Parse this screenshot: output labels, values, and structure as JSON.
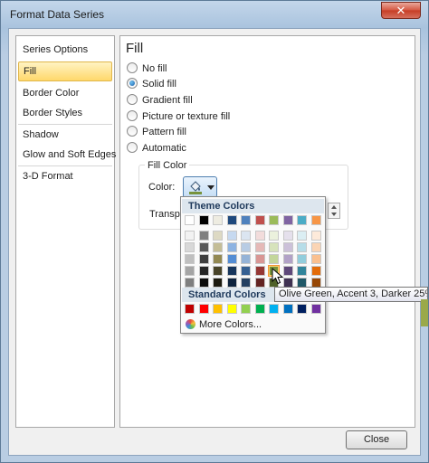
{
  "window": {
    "title": "Format Data Series",
    "close_glyph": "✕"
  },
  "nav": {
    "items": [
      {
        "label": "Series Options"
      },
      {
        "label": "Fill"
      },
      {
        "label": "Border Color"
      },
      {
        "label": "Border Styles"
      },
      {
        "label": "Shadow"
      },
      {
        "label": "Glow and Soft Edges"
      },
      {
        "label": "3-D Format"
      }
    ],
    "selected": "Fill"
  },
  "fill": {
    "heading": "Fill",
    "options": [
      {
        "label": "No fill",
        "selected": false
      },
      {
        "label": "Solid fill",
        "selected": true
      },
      {
        "label": "Gradient fill",
        "selected": false
      },
      {
        "label": "Picture or texture fill",
        "selected": false
      },
      {
        "label": "Pattern fill",
        "selected": false
      },
      {
        "label": "Automatic",
        "selected": false
      }
    ],
    "fill_color_group": "Fill Color",
    "color_label": "Color:",
    "transparency_label": "Transparency:",
    "color_button_icon": "paint-bucket-icon",
    "current_color": "#77933c"
  },
  "palette": {
    "theme_header": "Theme Colors",
    "standard_header": "Standard Colors",
    "more_colors": "More Colors...",
    "theme_rows": [
      [
        "#ffffff",
        "#000000",
        "#eeece1",
        "#1f497d",
        "#4f81bd",
        "#c0504d",
        "#9bbb59",
        "#8064a2",
        "#4bacc6",
        "#f79646"
      ],
      [
        "#f2f2f2",
        "#7f7f7f",
        "#ddd9c3",
        "#c6d9f0",
        "#dbe5f1",
        "#f2dcdb",
        "#ebf1dd",
        "#e5e0ec",
        "#dbeef3",
        "#fdeada"
      ],
      [
        "#d8d8d8",
        "#595959",
        "#c4bd97",
        "#8db3e2",
        "#b8cce4",
        "#e5b9b7",
        "#d7e3bc",
        "#ccc1d9",
        "#b7dde8",
        "#fbd5b5"
      ],
      [
        "#bfbfbf",
        "#3f3f3f",
        "#938953",
        "#548dd4",
        "#95b3d7",
        "#d99694",
        "#c3d69b",
        "#b2a2c7",
        "#92cddc",
        "#fac08f"
      ],
      [
        "#a5a5a5",
        "#262626",
        "#494429",
        "#17365d",
        "#366092",
        "#953734",
        "#76923c",
        "#5f497a",
        "#31859b",
        "#e36c09"
      ],
      [
        "#7f7f7f",
        "#0c0c0c",
        "#1d1b10",
        "#0f243e",
        "#244061",
        "#632423",
        "#4f6128",
        "#3f3151",
        "#205867",
        "#974806"
      ]
    ],
    "standard_row": [
      "#c00000",
      "#ff0000",
      "#ffc000",
      "#ffff00",
      "#92d050",
      "#00b050",
      "#00b0f0",
      "#0070c0",
      "#002060",
      "#7030a0"
    ],
    "hovered": {
      "row": 4,
      "col": 6
    }
  },
  "tooltip": {
    "text": "Olive Green, Accent 3, Darker 25%"
  },
  "buttons": {
    "close": "Close"
  }
}
